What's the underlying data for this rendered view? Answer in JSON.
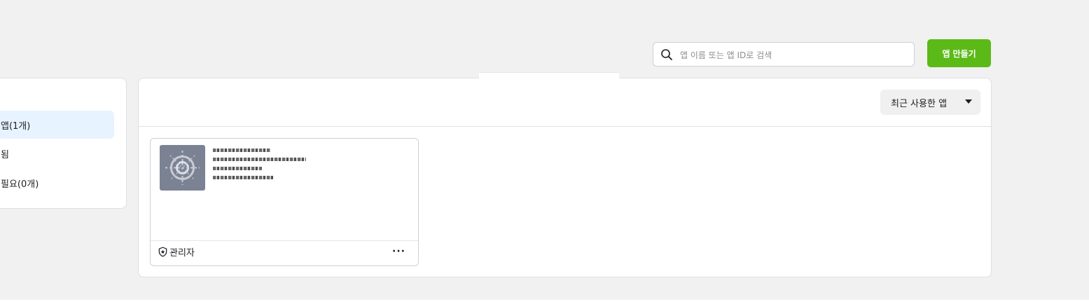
{
  "search": {
    "placeholder": "앱 이름 또는 앱 ID로 검색",
    "value": ""
  },
  "toolbar": {
    "create_app_label": "앱 만들기"
  },
  "sidebar": {
    "items": [
      {
        "label": "앱(1개)",
        "active": true
      },
      {
        "label": "됨",
        "active": false
      },
      {
        "label": "필요(0개)",
        "active": false
      }
    ]
  },
  "main": {
    "sort": {
      "label": "최근 사용한 앱",
      "icon": "caret-down-icon"
    }
  },
  "app_card": {
    "role": {
      "label": "관리자",
      "icon": "shield-icon"
    },
    "more_label": "···",
    "thumbnail_color": "#7a8294"
  },
  "colors": {
    "accent": "#5cba18",
    "active_bg": "#e7f3ff",
    "page_bg": "#f1f1f1"
  }
}
